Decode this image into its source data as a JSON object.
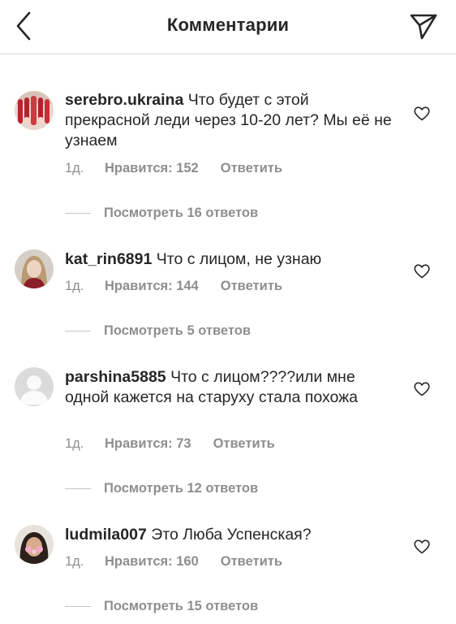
{
  "header": {
    "title": "Комментарии",
    "back_icon": "chevron-left-icon",
    "share_icon": "paper-plane-icon"
  },
  "comments": [
    {
      "username": "serebro.ukraina",
      "text": "Что будет с этой прекрасной леди через 10-20 лет? Мы её не узнаем",
      "time": "1д.",
      "likes": "Нравится: 152",
      "reply": "Ответить",
      "view_replies": "Посмотреть 16 ответов"
    },
    {
      "username": "kat_rin6891",
      "text": "Что с лицом, не узнаю",
      "time": "1д.",
      "likes": "Нравится: 144",
      "reply": "Ответить",
      "view_replies": "Посмотреть 5 ответов"
    },
    {
      "username": "parshina5885",
      "text": "Что с лицом????или мне одной кажется на  старуху стала похожа",
      "time": "1д.",
      "likes": "Нравится: 73",
      "reply": "Ответить",
      "view_replies": "Посмотреть 12 ответов"
    },
    {
      "username": "ludmila007",
      "text": "Это Люба Успенская?",
      "time": "1д.",
      "likes": "Нравится: 160",
      "reply": "Ответить",
      "view_replies": "Посмотреть 15 ответов"
    }
  ],
  "colors": {
    "text": "#262626",
    "secondary": "#8e8e8e",
    "divider": "#dbdbdb"
  }
}
